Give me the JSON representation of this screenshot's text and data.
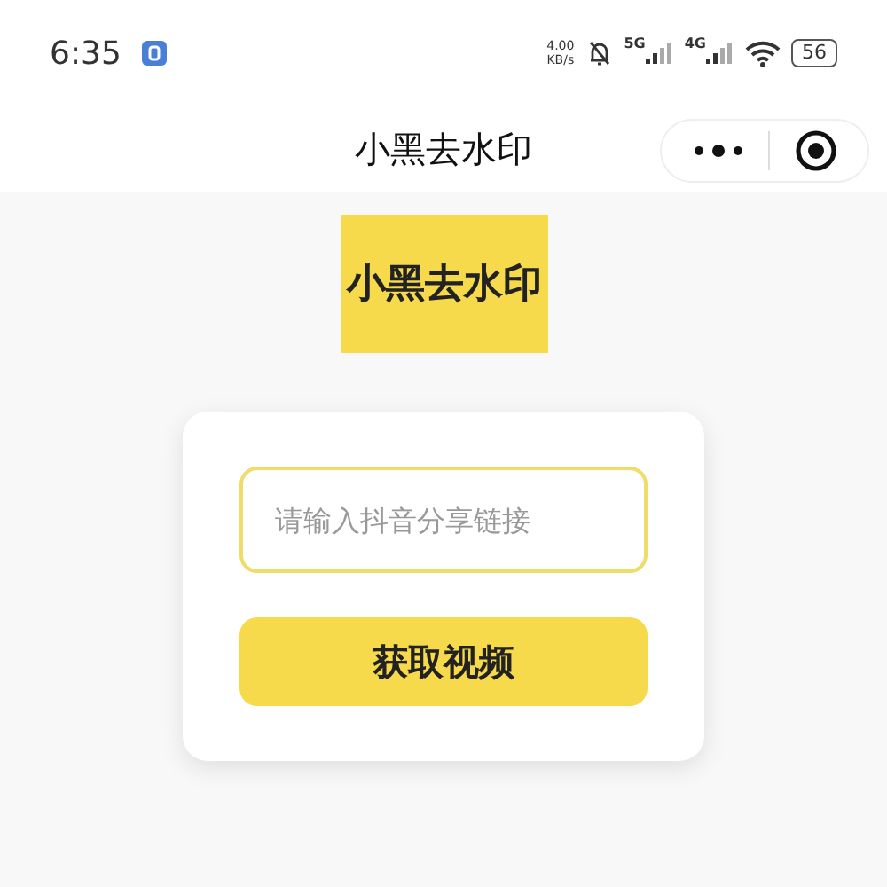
{
  "status_bar": {
    "time": "6:35",
    "speed_value": "4.00",
    "speed_unit": "KB/s",
    "net_5g": "5G",
    "net_4g": "4G",
    "battery": "56"
  },
  "nav": {
    "title": "小黑去水印"
  },
  "logo": {
    "text": "小黑去水印"
  },
  "form": {
    "placeholder": "请输入抖音分享链接",
    "button": "获取视频"
  }
}
